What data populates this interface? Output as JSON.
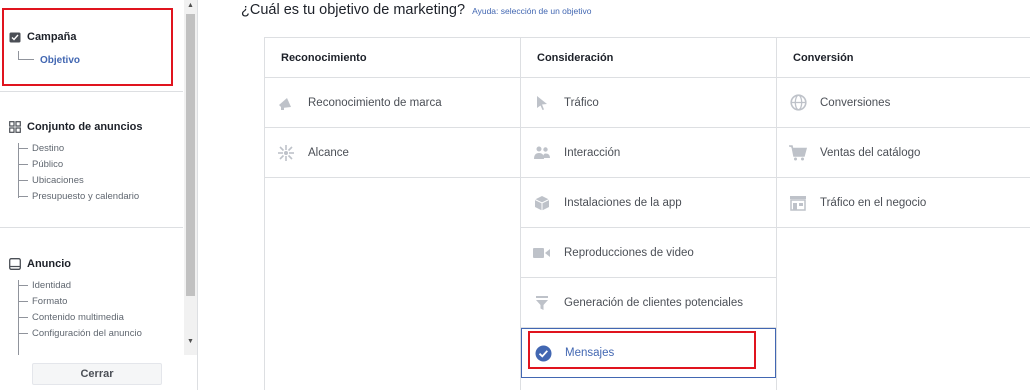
{
  "sidebar": {
    "campaign": {
      "heading": "Campaña",
      "active_item": "Objetivo"
    },
    "adset": {
      "heading": "Conjunto de anuncios",
      "items": [
        "Destino",
        "Público",
        "Ubicaciones",
        "Presupuesto y calendario"
      ]
    },
    "ad": {
      "heading": "Anuncio",
      "items": [
        "Identidad",
        "Formato",
        "Contenido multimedia",
        "Configuración del anuncio"
      ]
    },
    "close_label": "Cerrar"
  },
  "main": {
    "title": "¿Cuál es tu objetivo de marketing?",
    "help_link": "Ayuda: selección de un objetivo",
    "columns": [
      {
        "heading": "Reconocimiento",
        "items": [
          {
            "label": "Reconocimiento de marca",
            "icon": "megaphone-icon"
          },
          {
            "label": "Alcance",
            "icon": "reach-icon"
          }
        ]
      },
      {
        "heading": "Consideración",
        "items": [
          {
            "label": "Tráfico",
            "icon": "cursor-icon"
          },
          {
            "label": "Interacción",
            "icon": "people-icon"
          },
          {
            "label": "Instalaciones de la app",
            "icon": "box-icon"
          },
          {
            "label": "Reproducciones de video",
            "icon": "video-icon"
          },
          {
            "label": "Generación de clientes potenciales",
            "icon": "funnel-icon"
          },
          {
            "label": "Mensajes",
            "icon": "check-circle-icon",
            "selected": true
          }
        ]
      },
      {
        "heading": "Conversión",
        "items": [
          {
            "label": "Conversiones",
            "icon": "globe-icon"
          },
          {
            "label": "Ventas del catálogo",
            "icon": "cart-icon"
          },
          {
            "label": "Tráfico en el negocio",
            "icon": "store-icon"
          }
        ]
      }
    ]
  },
  "colors": {
    "accent": "#4267b2",
    "highlight_box": "#e0141e",
    "icon_gray": "#bec2c9"
  }
}
